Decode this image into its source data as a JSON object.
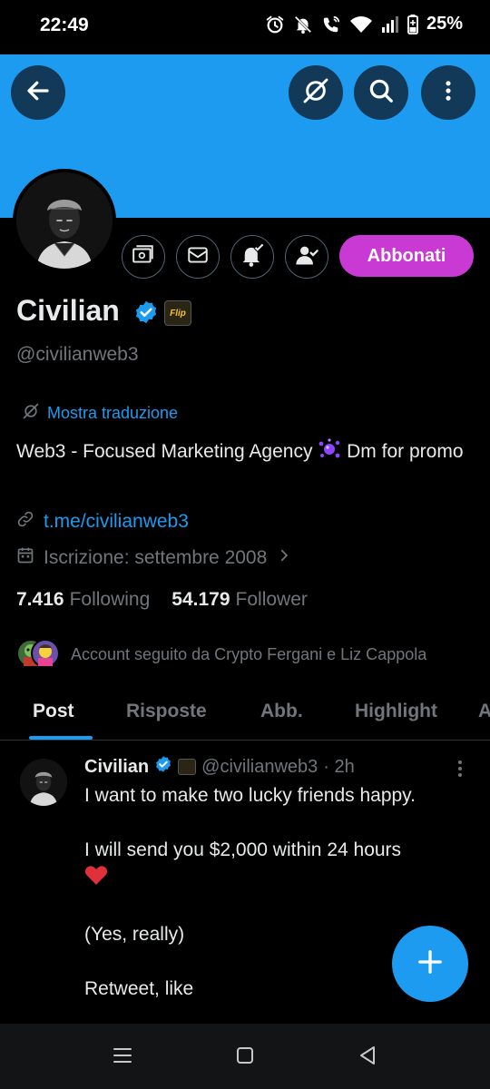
{
  "status_bar": {
    "time": "22:49",
    "battery": "25%",
    "icons": [
      "alarm-icon",
      "bell-off-icon",
      "wifi-call-icon",
      "wifi-icon",
      "signal-icon",
      "battery-icon"
    ]
  },
  "header": {
    "banner_color": "#1d9bf0",
    "back_icon": "arrow-left-icon",
    "grok_icon": "grok-icon",
    "search_icon": "search-icon",
    "more_icon": "more-vertical-icon"
  },
  "profile": {
    "name": "Civilian",
    "handle": "@civilianweb3",
    "affiliate_badge": "Flip",
    "subscribe_label": "Abbonati",
    "subscribe_color": "#c939d4",
    "translate_label": "Mostra traduzione",
    "bio_part1": "Web3 - Focused Marketing Agency",
    "bio_part2": "Dm for promo",
    "link": "t.me/civilianweb3",
    "joined": "Iscrizione: settembre 2008",
    "following_count": "7.416",
    "following_label": "Following",
    "followers_count": "54.179",
    "followers_label": "Follower",
    "followed_by": "Account seguito da Crypto Fergani e Liz Cappola"
  },
  "tabs": [
    {
      "label": "Post"
    },
    {
      "label": "Risposte"
    },
    {
      "label": "Abb."
    },
    {
      "label": "Highlight"
    },
    {
      "label": "A"
    }
  ],
  "post": {
    "name": "Civilian",
    "handle": "@civilianweb3",
    "time": "· 2h",
    "line1": "I want to make two lucky friends happy.",
    "line2": "I will send you $2,000 within 24 hours",
    "line3": "(Yes, really)",
    "line4": "Retweet, like"
  },
  "colors": {
    "accent": "#1d9bf0",
    "muted": "#71767b",
    "text": "#e7e9ea"
  }
}
